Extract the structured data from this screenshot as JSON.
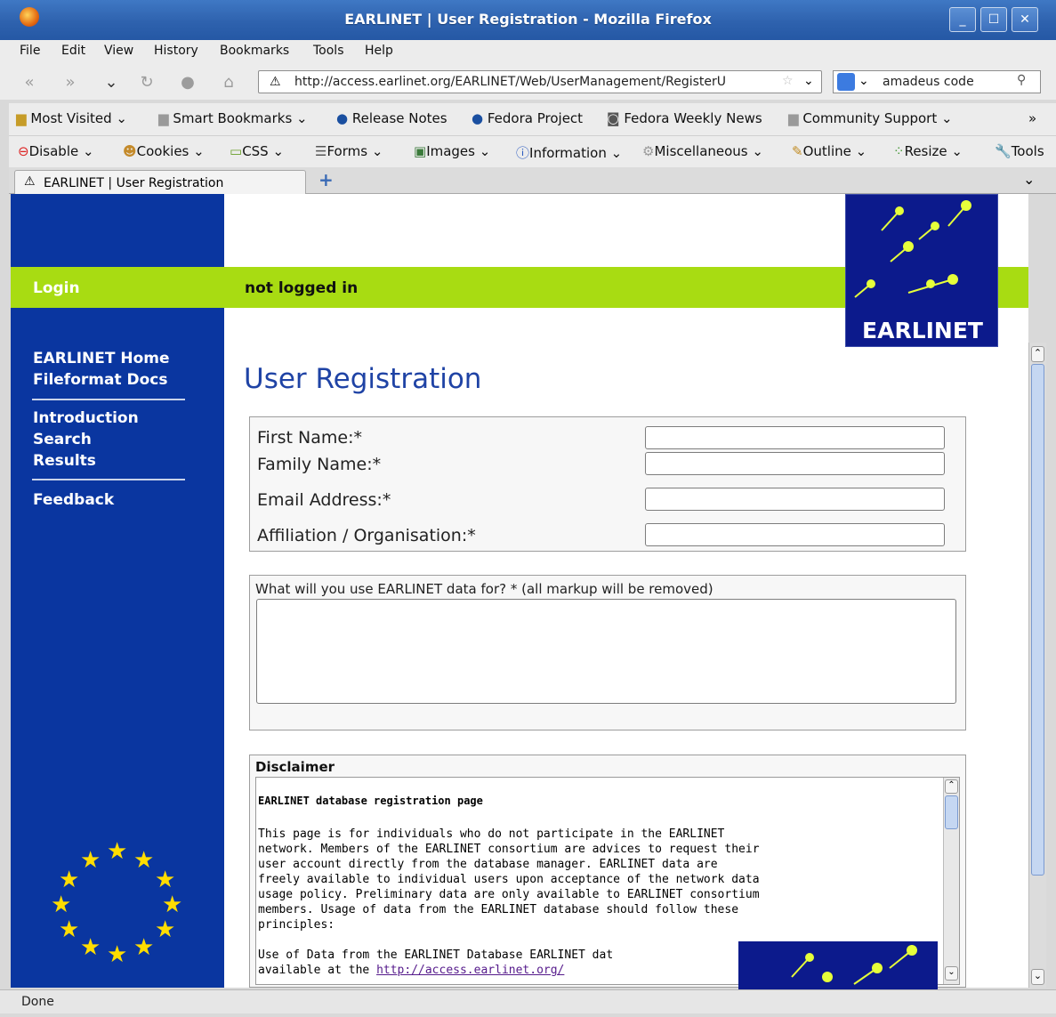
{
  "window": {
    "title": "EARLINET | User Registration - Mozilla Firefox"
  },
  "menu": [
    "File",
    "Edit",
    "View",
    "History",
    "Bookmarks",
    "Tools",
    "Help"
  ],
  "nav": {
    "url": "http://access.earlinet.org/EARLINET/Web/UserManagement/RegisterU",
    "search_value": "amadeus code"
  },
  "bookmarks": [
    "Most Visited",
    "Smart Bookmarks",
    "Release Notes",
    "Fedora Project",
    "Fedora Weekly News",
    "Community Support",
    "»"
  ],
  "webdev": [
    "Disable",
    "Cookies",
    "CSS",
    "Forms",
    "Images",
    "Information",
    "Miscellaneous",
    "Outline",
    "Resize",
    "Tools"
  ],
  "tab": {
    "label": "EARLINET | User Registration",
    "new_tab": "+"
  },
  "site": {
    "login_label": "Login",
    "status": "not logged in",
    "logo_text": "EARLINET",
    "sidebar": {
      "group1": [
        "EARLINET Home",
        "Fileformat Docs"
      ],
      "group2": [
        "Introduction",
        "Search",
        "Results"
      ],
      "group3": [
        "Feedback"
      ]
    },
    "heading": "User Registration",
    "form": {
      "first_name": "First Name:*",
      "family_name": "Family Name:*",
      "email": "Email Address:*",
      "affiliation": "Affiliation / Organisation:*",
      "usage_label": "What will you use EARLINET data for? * (all markup will be removed)"
    },
    "disclaimer": {
      "title": "Disclaimer",
      "heading": "EARLINET database registration page",
      "lines": [
        "This page is for individuals who do not participate in the EARLINET",
        "network. Members of the EARLINET consortium are advices to request their",
        "user account directly from the database manager. EARLINET data are",
        "freely available to individual users upon acceptance of the network data",
        "usage policy. Preliminary data are only available to EARLINET consortium",
        "members. Usage of data from the EARLINET database should follow these",
        "principles:"
      ],
      "line_after_1": "Use of Data from the EARLINET Database EARLINET dat",
      "line_after_2": "available at the ",
      "link": "http://access.earlinet.org/"
    }
  },
  "status": "Done"
}
